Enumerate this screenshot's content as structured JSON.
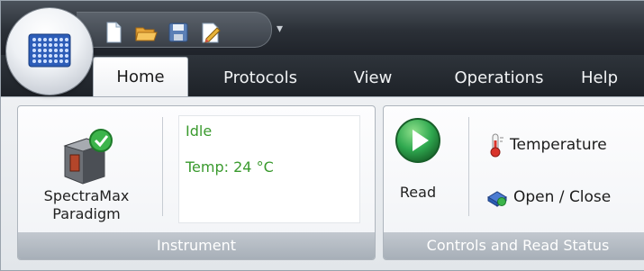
{
  "app": {
    "quick_access_icons": [
      "new-document-icon",
      "open-folder-icon",
      "save-icon",
      "edit-document-icon"
    ],
    "qat_dropdown_icon": "customize-dropdown-icon",
    "orb_icon": "microplate-icon"
  },
  "tabs": [
    {
      "label": "Home",
      "active": true
    },
    {
      "label": "Protocols",
      "active": false
    },
    {
      "label": "View",
      "active": false
    },
    {
      "label": "Operations",
      "active": false
    },
    {
      "label": "Help",
      "active": false
    }
  ],
  "instrument_group": {
    "caption": "Instrument",
    "device_label": "SpectraMax Paradigm",
    "device_label_line1": "SpectraMax",
    "device_label_line2": "Paradigm",
    "status": "Idle",
    "temperature": "Temp: 24 °C",
    "status_color": "#3a9a2e"
  },
  "controls_group": {
    "caption": "Controls and Read Status",
    "read_label": "Read",
    "temperature_label": "Temperature",
    "open_close_label": "Open / Close"
  },
  "colors": {
    "accent_green": "#2fa84f",
    "title_bar": "#2b3037"
  }
}
